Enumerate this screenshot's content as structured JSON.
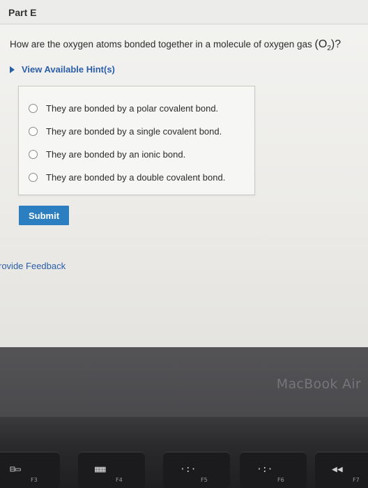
{
  "part": {
    "title": "Part E"
  },
  "question": {
    "text": "How are the oxygen atoms bonded together in a molecule of oxygen gas",
    "formula_open": "(O",
    "formula_sub": "2",
    "formula_close": ")?"
  },
  "hint": {
    "label": "View Available Hint(s)"
  },
  "options": [
    {
      "label": "They are bonded by a polar covalent bond."
    },
    {
      "label": "They are bonded by a single covalent bond."
    },
    {
      "label": "They are bonded by an ionic bond."
    },
    {
      "label": "They are bonded by a double covalent bond."
    }
  ],
  "submit": {
    "label": "Submit"
  },
  "feedback": {
    "label": "rovide Feedback"
  },
  "laptop": {
    "brand": "MacBook Air"
  },
  "keyboard": {
    "keys": [
      {
        "glyph": "⊟▭",
        "label": "F3"
      },
      {
        "glyph": "▦▦",
        "label": "F4"
      },
      {
        "glyph": "·:·",
        "label": "F5"
      },
      {
        "glyph": "·:·",
        "label": "F6"
      },
      {
        "glyph": "◀◀",
        "label": "F7"
      }
    ]
  },
  "colors": {
    "accent": "#2b7fc1",
    "link": "#2a5ea8"
  }
}
